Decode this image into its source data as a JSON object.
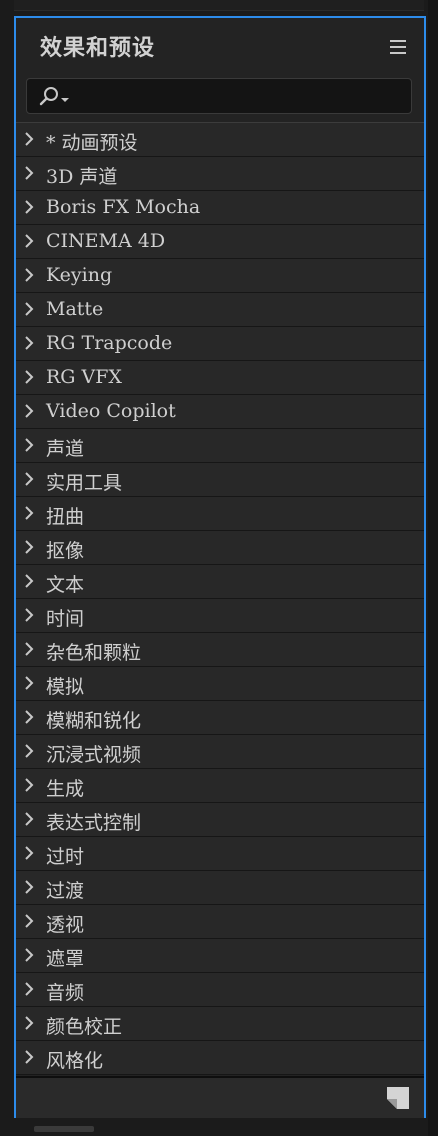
{
  "panel": {
    "title": "效果和预设",
    "menu_icon": "hamburger-menu-icon",
    "search": {
      "icon": "search-icon",
      "value": "",
      "placeholder": ""
    },
    "items": [
      {
        "label": "* 动画预设"
      },
      {
        "label": "3D 声道"
      },
      {
        "label": "Boris FX Mocha"
      },
      {
        "label": "CINEMA 4D"
      },
      {
        "label": "Keying"
      },
      {
        "label": "Matte"
      },
      {
        "label": "RG Trapcode"
      },
      {
        "label": "RG VFX"
      },
      {
        "label": "Video Copilot"
      },
      {
        "label": "声道"
      },
      {
        "label": "实用工具"
      },
      {
        "label": "扭曲"
      },
      {
        "label": "抠像"
      },
      {
        "label": "文本"
      },
      {
        "label": "时间"
      },
      {
        "label": "杂色和颗粒"
      },
      {
        "label": "模拟"
      },
      {
        "label": "模糊和锐化"
      },
      {
        "label": "沉浸式视频"
      },
      {
        "label": "生成"
      },
      {
        "label": "表达式控制"
      },
      {
        "label": "过时"
      },
      {
        "label": "过渡"
      },
      {
        "label": "透视"
      },
      {
        "label": "遮罩"
      },
      {
        "label": "音频"
      },
      {
        "label": "颜色校正"
      },
      {
        "label": "风格化"
      }
    ],
    "footer": {
      "new_item_icon": "new-preset-icon"
    }
  },
  "colors": {
    "focus_border": "#2d8ceb",
    "panel_bg": "#232323",
    "row_bg": "#282828"
  }
}
